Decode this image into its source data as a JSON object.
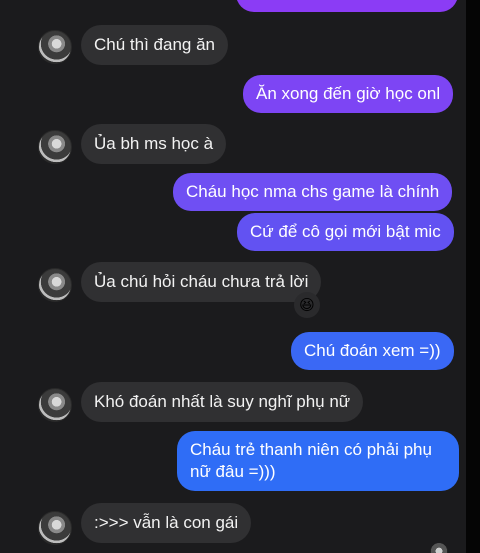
{
  "colors": {
    "incoming_bubble": "#303032",
    "outgoing_bubble_purple": "#7a45f0",
    "outgoing_bubble_blue": "#2f6df6",
    "chat_background": "#1b1b1d"
  },
  "messages": [
    {
      "side": "in",
      "text": "Chú thì đang ăn"
    },
    {
      "side": "out",
      "text": "Ăn xong đến giờ học onl"
    },
    {
      "side": "in",
      "text": "Ủa bh ms học à"
    },
    {
      "side": "out",
      "text": "Cháu học nma chs game là chính"
    },
    {
      "side": "out",
      "text": "Cứ để cô gọi mới bật mic"
    },
    {
      "side": "in",
      "text": "Ủa chú hỏi cháu chưa trả lời",
      "reaction": "😆"
    },
    {
      "side": "out",
      "text": "Chú đoán xem =))"
    },
    {
      "side": "in",
      "text": "Khó đoán nhất là suy nghĩ phụ nữ"
    },
    {
      "side": "out",
      "text_line1": "Cháu trẻ thanh niên có phải phụ",
      "text_line2": "nữ đâu =)))"
    },
    {
      "side": "in",
      "text": ":>>> vẫn là con gái"
    }
  ]
}
